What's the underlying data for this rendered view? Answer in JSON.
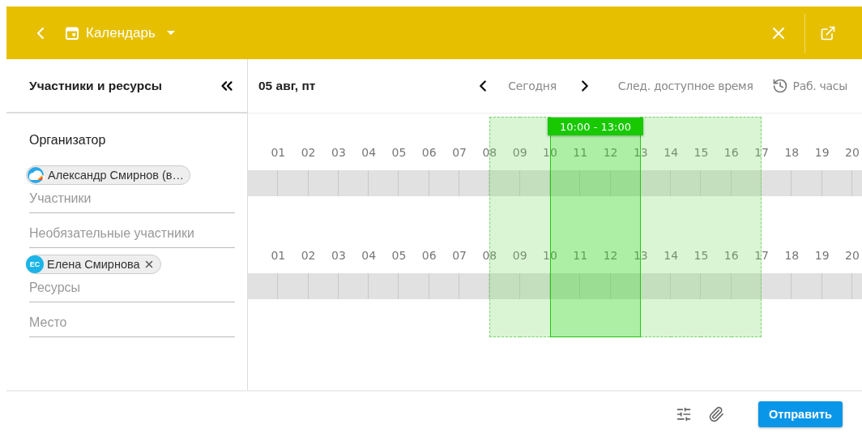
{
  "header": {
    "title": "Календарь"
  },
  "sidebar": {
    "title": "Участники и ресурсы",
    "fields": [
      {
        "kind": "heading",
        "text": "Организатор"
      },
      {
        "kind": "chip",
        "text": "Александр Смирнов (в…",
        "removable": false
      },
      {
        "kind": "input",
        "placeholder": "Участники"
      },
      {
        "kind": "input",
        "placeholder": "Необязательные участники"
      },
      {
        "kind": "chip",
        "text": "Елена Смирнова",
        "initials": "ЕС",
        "removable": true
      },
      {
        "kind": "input",
        "placeholder": "Ресурсы"
      },
      {
        "kind": "input",
        "placeholder": "Место"
      }
    ]
  },
  "toolbar": {
    "date": "05 авг, пт",
    "today": "Сегодня",
    "next_free": "След. доступное время",
    "work_hours": "Раб. часы"
  },
  "timeline": {
    "rows": [
      {
        "hours": [
          "01",
          "02",
          "03",
          "04",
          "05",
          "06",
          "07",
          "08",
          "09",
          "10",
          "11",
          "12",
          "13",
          "14",
          "15",
          "16",
          "17",
          "18",
          "19",
          "20"
        ]
      },
      {
        "hours": [
          "01",
          "02",
          "03",
          "04",
          "05",
          "06",
          "07",
          "08",
          "09",
          "10",
          "11",
          "12",
          "13",
          "14",
          "15",
          "16",
          "17",
          "18",
          "19",
          "20"
        ]
      }
    ],
    "selection_label": "10:00 - 13:00",
    "slots": [
      {
        "working": false,
        "selected": false
      },
      {
        "working": false,
        "selected": false
      },
      {
        "working": false,
        "selected": false
      },
      {
        "working": false,
        "selected": false
      },
      {
        "working": false,
        "selected": false
      },
      {
        "working": false,
        "selected": false
      },
      {
        "working": false,
        "selected": false
      },
      {
        "working": false,
        "selected": false
      },
      {
        "working": true,
        "selected": false
      },
      {
        "working": true,
        "selected": false
      },
      {
        "working": true,
        "selected": true
      },
      {
        "working": true,
        "selected": true
      },
      {
        "working": true,
        "selected": true
      },
      {
        "working": true,
        "selected": false
      },
      {
        "working": true,
        "selected": false
      },
      {
        "working": true,
        "selected": false
      },
      {
        "working": true,
        "selected": false
      },
      {
        "working": false,
        "selected": false
      },
      {
        "working": false,
        "selected": false
      },
      {
        "working": false,
        "selected": false
      }
    ]
  },
  "footer": {
    "submit": "Отправить"
  }
}
